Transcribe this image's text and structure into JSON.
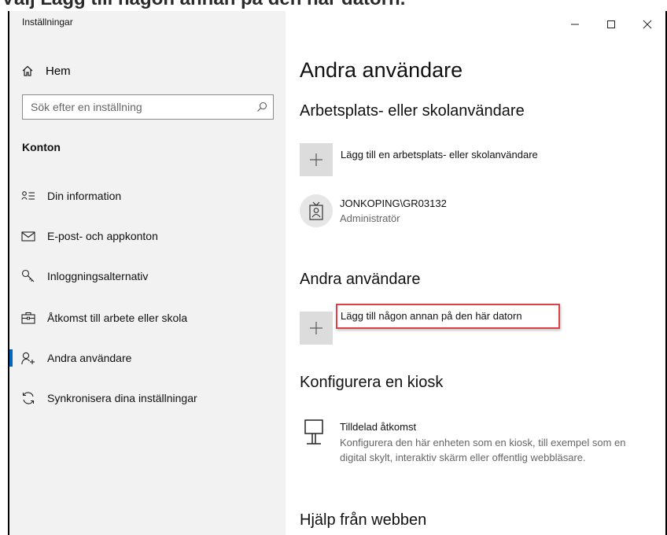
{
  "top_caption": "Välj Lägg till någon annan på den här datorn.",
  "app": {
    "title": "Inställningar"
  },
  "window_controls": {
    "minimize": "–",
    "maximize": "☐",
    "close": "✕"
  },
  "sidebar": {
    "home_label": "Hem",
    "search_placeholder": "Sök efter en inställning",
    "section": "Konton",
    "items": [
      {
        "label": "Din information",
        "icon": "person-card-icon"
      },
      {
        "label": "E-post- och appkonton",
        "icon": "mail-icon"
      },
      {
        "label": "Inloggningsalternativ",
        "icon": "key-icon"
      },
      {
        "label": "Åtkomst till arbete eller skola",
        "icon": "briefcase-icon"
      },
      {
        "label": "Andra användare",
        "icon": "person-add-icon",
        "active": true
      },
      {
        "label": "Synkronisera dina inställningar",
        "icon": "sync-icon"
      }
    ]
  },
  "main": {
    "title": "Andra användare",
    "work_section": {
      "heading": "Arbetsplats- eller skolanvändare",
      "add_label": "Lägg till en arbetsplats- eller skolanvändare",
      "user_name": "JONKOPING\\GR03132",
      "user_role": "Administratör"
    },
    "other_section": {
      "heading": "Andra användare",
      "add_label": "Lägg till någon annan på den här datorn"
    },
    "kiosk_section": {
      "heading": "Konfigurera en kiosk",
      "title": "Tilldelad åtkomst",
      "description": "Konfigurera den här enheten som en kiosk, till exempel som en digital skylt, interaktiv skärm eller offentlig webbläsare."
    },
    "help_heading": "Hjälp från webben"
  },
  "colors": {
    "accent": "#0067c0",
    "highlight_box": "#e04048",
    "sidebar_bg": "#f2f2f2",
    "tile_bg": "#dcdcdc"
  }
}
